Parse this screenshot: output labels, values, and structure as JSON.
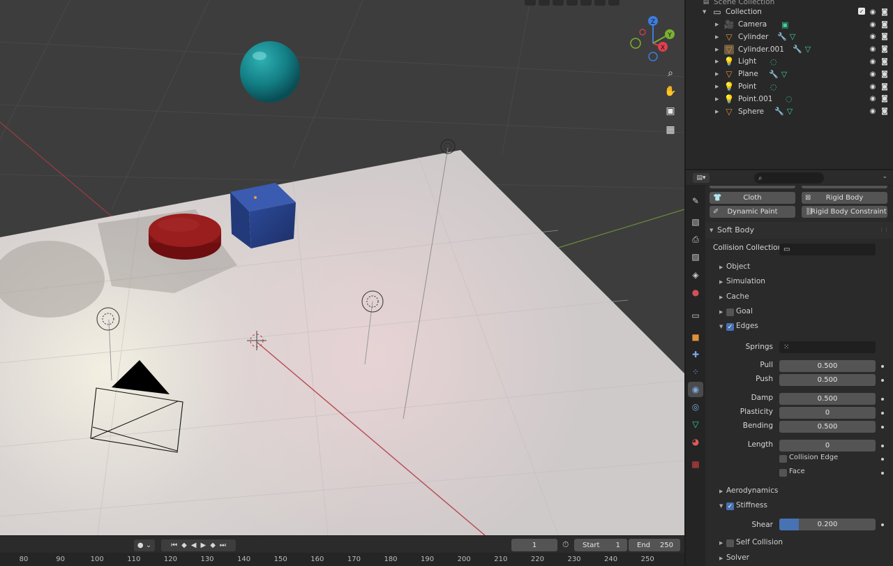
{
  "outliner": {
    "scene_collection": "Scene Collection",
    "collection": "Collection",
    "items": [
      {
        "name": "Camera",
        "icon": "camera-icon",
        "modifiers": [
          "camera-data-icon"
        ]
      },
      {
        "name": "Cylinder",
        "icon": "mesh-icon",
        "modifiers": [
          "wrench-icon",
          "mesh-data-icon"
        ]
      },
      {
        "name": "Cylinder.001",
        "icon": "mesh-icon",
        "modifiers": [
          "wrench-icon",
          "mesh-data-icon"
        ]
      },
      {
        "name": "Light",
        "icon": "light-icon",
        "modifiers": [
          "light-data-icon"
        ]
      },
      {
        "name": "Plane",
        "icon": "mesh-icon",
        "modifiers": [
          "wrench-icon",
          "mesh-data-icon"
        ]
      },
      {
        "name": "Point",
        "icon": "light-icon",
        "modifiers": [
          "light-data-icon"
        ]
      },
      {
        "name": "Point.001",
        "icon": "light-icon",
        "modifiers": [
          "light-data-icon"
        ]
      },
      {
        "name": "Sphere",
        "icon": "mesh-icon",
        "modifiers": [
          "wrench-icon",
          "mesh-data-icon"
        ]
      }
    ]
  },
  "physics": {
    "cloth": "Cloth",
    "rigid_body": "Rigid Body",
    "dynamic_paint": "Dynamic Paint",
    "rigid_body_constraint": "Rigid Body Constraint",
    "soft_body": "Soft Body",
    "collision_collection_label": "Collision Collection",
    "object": "Object",
    "simulation": "Simulation",
    "cache": "Cache",
    "goal": "Goal",
    "edges": "Edges",
    "springs_label": "Springs",
    "pull_label": "Pull",
    "pull": "0.500",
    "push_label": "Push",
    "push": "0.500",
    "damp_label": "Damp",
    "damp": "0.500",
    "plasticity_label": "Plasticity",
    "plasticity": "0",
    "bending_label": "Bending",
    "bending": "0.500",
    "length_label": "Length",
    "length": "0",
    "collision_edge": "Collision Edge",
    "face": "Face",
    "aerodynamics": "Aerodynamics",
    "stiffness": "Stiffness",
    "shear_label": "Shear",
    "shear": "0.200",
    "shear_fraction": 0.2,
    "self_collision": "Self Collision",
    "solver": "Solver"
  },
  "timeline": {
    "current_frame": "1",
    "start_label": "Start",
    "start": "1",
    "end_label": "End",
    "end": "250",
    "ticks": [
      "80",
      "90",
      "100",
      "110",
      "120",
      "130",
      "140",
      "150",
      "160",
      "170",
      "180",
      "190",
      "200",
      "210",
      "220",
      "230",
      "240",
      "250"
    ]
  },
  "colors": {
    "accent": "#4772b3",
    "object_orange": "#e0913c",
    "data_green": "#3dd09c"
  }
}
